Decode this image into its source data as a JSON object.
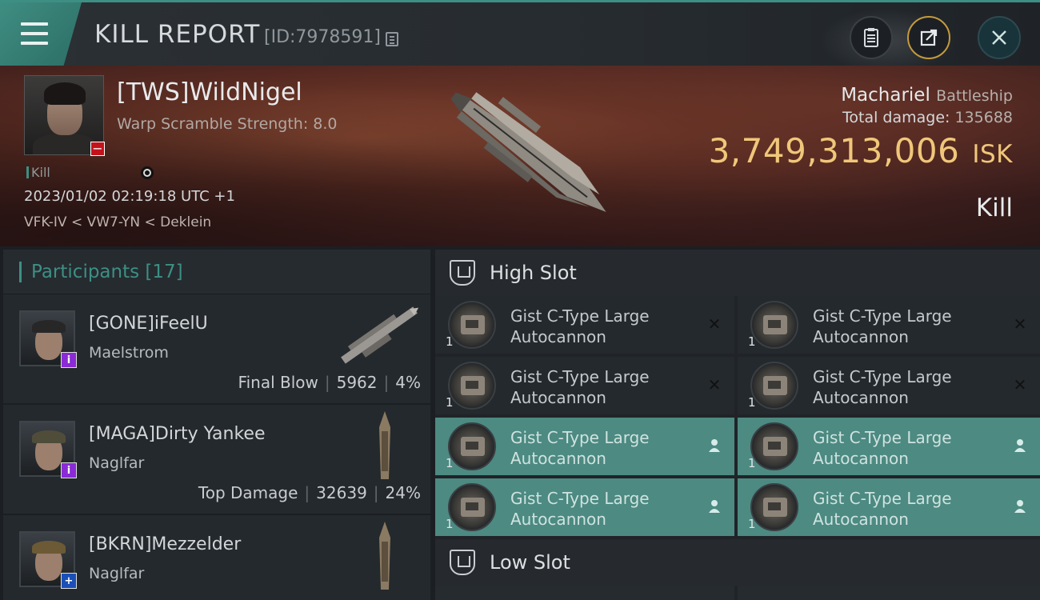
{
  "header": {
    "title": "KILL REPORT",
    "report_id": "[ID:7978591]",
    "icons": [
      "menu-icon",
      "copy-icon",
      "clipboard-icon",
      "share-icon",
      "close-icon"
    ]
  },
  "victim": {
    "name": "[TWS]WildNigel",
    "subtitle": "Warp Scramble Strength: 8.0",
    "tag": "Kill",
    "datetime": "2023/01/02 02:19:18 UTC +1",
    "location": "VFK-IV < VW7-YN < Deklein",
    "ship_name": "Machariel",
    "ship_class": "Battleship",
    "total_damage_label": "Total damage:",
    "total_damage": "135688",
    "isk_value": "3,749,313,006",
    "isk_unit": "ISK",
    "result": "Kill",
    "badge": "−"
  },
  "participants": {
    "label": "Participants [17]",
    "rows": [
      {
        "name": "[GONE]iFeelU",
        "ship": "Maelstrom",
        "role": "Final Blow",
        "damage": "5962",
        "percent": "4%",
        "badge": "i",
        "badge_color": "#8a2bd6"
      },
      {
        "name": "[MAGA]Dirty Yankee",
        "ship": "Naglfar",
        "role": "Top Damage",
        "damage": "32639",
        "percent": "24%",
        "badge": "i",
        "badge_color": "#8a2bd6"
      },
      {
        "name": "[BKRN]Mezzelder",
        "ship": "Naglfar",
        "role": "",
        "damage": "",
        "percent": "",
        "badge": "+",
        "badge_color": "#1b4fb8"
      }
    ]
  },
  "fitting": {
    "high_slot_label": "High Slot",
    "low_slot_label": "Low Slot",
    "modules": [
      {
        "line1": "Gist C-Type Large",
        "line2": "Autocannon",
        "qty": "1",
        "state": "destroyed"
      },
      {
        "line1": "Gist C-Type Large",
        "line2": "Autocannon",
        "qty": "1",
        "state": "destroyed"
      },
      {
        "line1": "Gist C-Type Large",
        "line2": "Autocannon",
        "qty": "1",
        "state": "destroyed"
      },
      {
        "line1": "Gist C-Type Large",
        "line2": "Autocannon",
        "qty": "1",
        "state": "destroyed"
      },
      {
        "line1": "Gist C-Type Large",
        "line2": "Autocannon",
        "qty": "1",
        "state": "dropped"
      },
      {
        "line1": "Gist C-Type Large",
        "line2": "Autocannon",
        "qty": "1",
        "state": "dropped"
      },
      {
        "line1": "Gist C-Type Large",
        "line2": "Autocannon",
        "qty": "1",
        "state": "dropped"
      },
      {
        "line1": "Gist C-Type Large",
        "line2": "Autocannon",
        "qty": "1",
        "state": "dropped"
      }
    ]
  },
  "colors": {
    "accent": "#3d8f84",
    "isk": "#f0c77a",
    "dropped_bg": "#4c8a82"
  }
}
